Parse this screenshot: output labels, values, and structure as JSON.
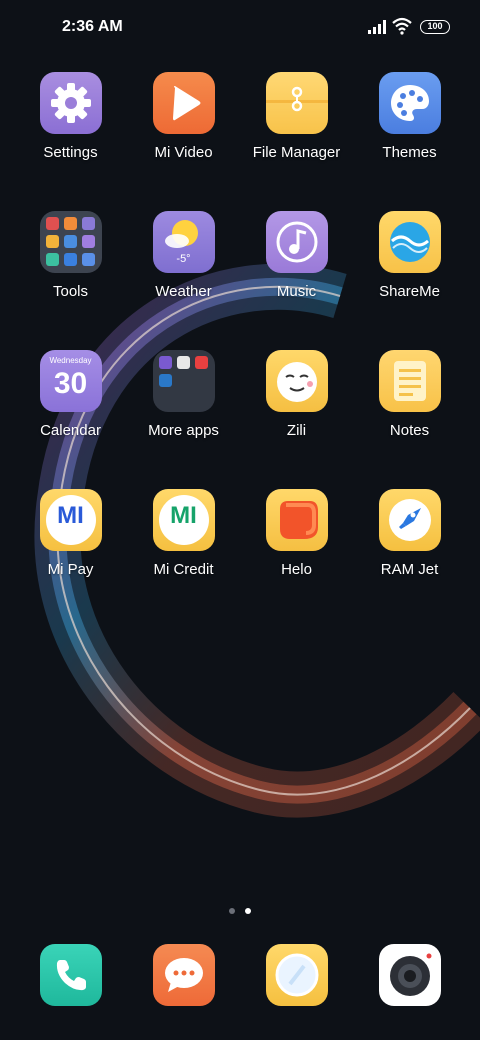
{
  "status_bar": {
    "time": "2:36 AM",
    "battery": "100"
  },
  "apps": [
    {
      "label": "Settings"
    },
    {
      "label": "Mi Video"
    },
    {
      "label": "File Manager"
    },
    {
      "label": "Themes"
    },
    {
      "label": "Tools"
    },
    {
      "label": "Weather",
      "temp": "-5°"
    },
    {
      "label": "Music"
    },
    {
      "label": "ShareMe"
    },
    {
      "label": "Calendar",
      "weekday": "Wednesday",
      "day": "30"
    },
    {
      "label": "More apps"
    },
    {
      "label": "Zili"
    },
    {
      "label": "Notes"
    },
    {
      "label": "Mi Pay",
      "logo": "MI"
    },
    {
      "label": "Mi Credit",
      "logo": "MI"
    },
    {
      "label": "Helo"
    },
    {
      "label": "RAM Jet"
    }
  ],
  "dock": [
    {
      "icon": "phone-icon"
    },
    {
      "icon": "messages-icon"
    },
    {
      "icon": "browser-icon"
    },
    {
      "icon": "camera-icon"
    }
  ],
  "pages": {
    "count": 2,
    "active": 2
  }
}
